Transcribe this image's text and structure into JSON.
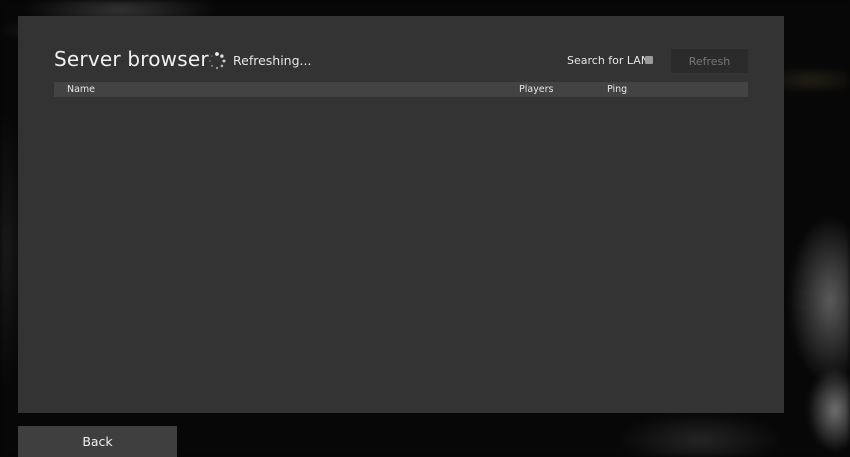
{
  "server_browser": {
    "title": "Server browser",
    "status_text": "Refreshing...",
    "status_icon": "loading-spinner-icon",
    "lan": {
      "label": "Search for LAN",
      "checked": false
    },
    "refresh_label": "Refresh",
    "columns": {
      "name": "Name",
      "players": "Players",
      "ping": "Ping"
    },
    "rows": []
  },
  "footer": {
    "back_label": "Back"
  }
}
